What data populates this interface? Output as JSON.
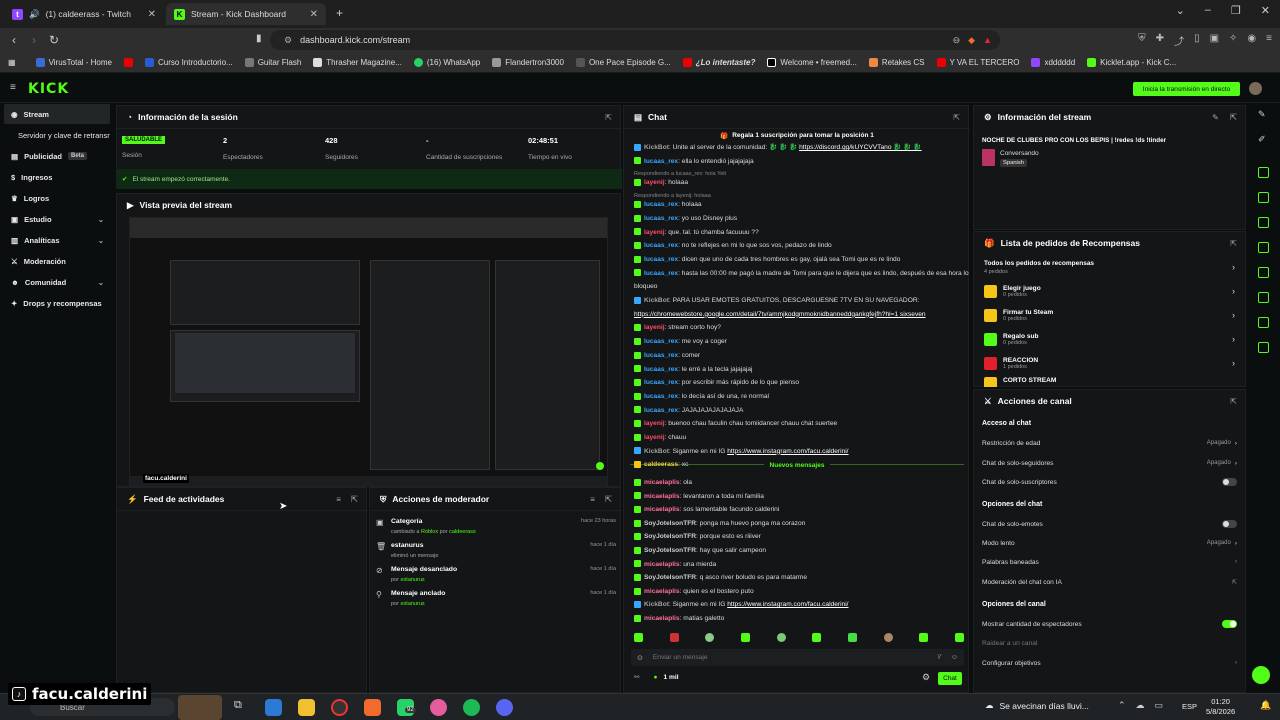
{
  "browser": {
    "tabs": [
      {
        "title": "(1) caldeerass - Twitch"
      },
      {
        "title": "Stream - Kick Dashboard"
      }
    ],
    "url": "dashboard.kick.com/stream",
    "bookmarks": [
      "VirusTotal - Home",
      "Curso Introductorio...",
      "Guitar Flash",
      "Thrasher Magazine...",
      "(16) WhatsApp",
      "Flandertron3000",
      "One Pace Episode G...",
      "¿Lo intentaste?",
      "Welcome • freemed...",
      "Retakes CS",
      "Y VA EL TERCERO",
      "xdddddd",
      "Kicklet.app - Kick C..."
    ]
  },
  "header": {
    "logo": "KICK",
    "go_live": "Inicia la transmisión en directo"
  },
  "sidebar": {
    "items": [
      {
        "label": "Stream"
      },
      {
        "label": "Servidor y clave de retransmisión"
      },
      {
        "label": "Publicidad",
        "badge": "Beta"
      },
      {
        "label": "Ingresos"
      },
      {
        "label": "Logros"
      },
      {
        "label": "Estudio"
      },
      {
        "label": "Analíticas"
      },
      {
        "label": "Moderación"
      },
      {
        "label": "Comunidad"
      },
      {
        "label": "Drops y recompensas"
      }
    ]
  },
  "session": {
    "title": "Información de la sesión",
    "status": "SALUDABLE",
    "status_label": "Sesión",
    "viewers": "2",
    "viewers_label": "Espectadores",
    "followers": "428",
    "followers_label": "Seguidores",
    "subs": "-",
    "subs_label": "Cantidad de suscripciones",
    "time": "02:48:51",
    "time_label": "Tiempo en vivo",
    "notice": "El stream empezó correctamente."
  },
  "preview": {
    "title": "Vista previa del stream",
    "overlay_name": "facu.calderini"
  },
  "feed": {
    "title": "Feed de actividades"
  },
  "modactions": {
    "title": "Acciones de moderador",
    "items": [
      {
        "title": "Categoría",
        "sub_pre": "cambiado a",
        "sub_a": "Roblox",
        "sub_mid": "por",
        "sub_b": "caldeerass",
        "time": "hace 23 horas"
      },
      {
        "title": "estanurus",
        "sub_pre": "eliminó un mensaje",
        "sub_a": "",
        "sub_mid": "",
        "sub_b": "",
        "time": "hace 1 día"
      },
      {
        "title": "Mensaje desanclado",
        "sub_pre": "por",
        "sub_a": "estanurus",
        "sub_mid": "",
        "sub_b": "",
        "time": "hace 1 día"
      },
      {
        "title": "Mensaje anclado",
        "sub_pre": "por",
        "sub_a": "estanurus",
        "sub_mid": "",
        "sub_b": "",
        "time": "hace 1 día"
      }
    ]
  },
  "chat": {
    "title": "Chat",
    "banner": "Regala 1 suscripción para tomar la posición 1",
    "new_messages": "Nuevos mensajes",
    "placeholder": "Enviar un mensaje",
    "viewers": "1 mil",
    "send": "Chat",
    "messages": [
      {
        "user": "KickBot",
        "color": "#a0a0a0",
        "text": "Unite al server de la comunidad: 🐉 🐉 🐉",
        "link": "https://discord.gg/kUYCVVTano 🐉 🐉 🐉"
      },
      {
        "user": "lucaas_rex",
        "color": "#3aa7ff",
        "text": "ella lo entendió jajajajaja"
      },
      {
        "reply": "Respondiendo a lucaas_rex: hola Yeti"
      },
      {
        "user": "layenij",
        "color": "#ff4d6a",
        "text": "holaaa"
      },
      {
        "reply": "Respondiendo a layenij: holaaa"
      },
      {
        "user": "lucaas_rex",
        "color": "#3aa7ff",
        "text": "holaaa"
      },
      {
        "user": "lucaas_rex",
        "color": "#3aa7ff",
        "text": "yo uso Disney plus"
      },
      {
        "user": "layenij",
        "color": "#ff4d6a",
        "text": "que. tal. tú chamba facuuuu ??"
      },
      {
        "user": "lucaas_rex",
        "color": "#3aa7ff",
        "text": "no te reflejes en mi lo que sos vos, pedazo de lindo"
      },
      {
        "user": "lucaas_rex",
        "color": "#3aa7ff",
        "text": "dicen que uno de cada tres hombres es gay, ojalá sea Tomi que es re lindo"
      },
      {
        "user": "lucaas_rex",
        "color": "#3aa7ff",
        "text": "hasta las 00:00 me pagó la madre de Tomi para que le dijera que es lindo, después de esa hora lo"
      },
      {
        "cont": "bloqueo"
      },
      {
        "user": "KickBot",
        "color": "#a0a0a0",
        "text": "PARA USAR EMOTES GRATUITOS, DESCARGUESNE 7TV EN SU NAVEGADOR:"
      },
      {
        "cont": "https://chromewebstore.google.com/detail/7tv/ammjkodgmmoknidbanneddgankgfejfh?hl=1 sixseven",
        "link_line": true
      },
      {
        "user": "layenij",
        "color": "#ff4d6a",
        "text": "stream corto hoy?"
      },
      {
        "user": "lucaas_rex",
        "color": "#3aa7ff",
        "text": "me voy a coger"
      },
      {
        "user": "lucaas_rex",
        "color": "#3aa7ff",
        "text": "comer"
      },
      {
        "user": "lucaas_rex",
        "color": "#3aa7ff",
        "text": "le erré a la tecla jajajajaj"
      },
      {
        "user": "lucaas_rex",
        "color": "#3aa7ff",
        "text": "por escribir más rápido de lo que pienso"
      },
      {
        "user": "lucaas_rex",
        "color": "#3aa7ff",
        "text": "lo decía así de una, re normal"
      },
      {
        "user": "lucaas_rex",
        "color": "#3aa7ff",
        "text": "JAJAJAJAJAJAJAJA"
      },
      {
        "user": "layenij",
        "color": "#ff4d6a",
        "text": "buenoo chau faculin chau tomiidancer chauu chat suertee"
      },
      {
        "user": "layenij",
        "color": "#ff4d6a",
        "text": "chauu"
      },
      {
        "user": "KickBot",
        "color": "#a0a0a0",
        "text": "Siganme en mi IG",
        "link": "https://www.instagram.com/facu.calderini/"
      },
      {
        "user": "caldeerass",
        "color": "#f5d142",
        "text": "xc"
      }
    ],
    "messages2": [
      {
        "user": "micaelaplis",
        "color": "#ff6f9c",
        "text": "ola"
      },
      {
        "user": "micaelaplis",
        "color": "#ff6f9c",
        "text": "levantaron a toda mi familia"
      },
      {
        "user": "micaelaplis",
        "color": "#ff6f9c",
        "text": "sos lamentable facundo calderini"
      },
      {
        "user": "SoyJotelsonTFR",
        "color": "#cfcfcf",
        "text": "ponga ma huevo ponga ma corazon"
      },
      {
        "user": "SoyJotelsonTFR",
        "color": "#cfcfcf",
        "text": "porque esto es riiiver"
      },
      {
        "user": "SoyJotelsonTFR",
        "color": "#cfcfcf",
        "text": "hay que salir campeon"
      },
      {
        "user": "micaelaplis",
        "color": "#ff6f9c",
        "text": "una mierda"
      },
      {
        "user": "SoyJotelsonTFR",
        "color": "#cfcfcf",
        "text": "q asco river boludo es para matarme"
      },
      {
        "user": "micaelaplis",
        "color": "#ff6f9c",
        "text": "quien es el bostero puto"
      },
      {
        "user": "KickBot",
        "color": "#a0a0a0",
        "text": "Siganme en mi IG",
        "link": "https://www.instagram.com/facu.calderini/"
      },
      {
        "user": "micaelaplis",
        "color": "#ff6f9c",
        "text": "matias galetto"
      }
    ]
  },
  "streaminfo": {
    "title": "Información del stream",
    "stream_title": "NOCHE DE CLUBES PRO CON LOS BEPIS | !redes !ds !tinder",
    "category": "Conversando",
    "lang": "Spanish"
  },
  "rewards": {
    "title": "Lista de pedidos de Recompensas",
    "all": "Todos los pedidos de recompensas",
    "all_count": "4 pedidos",
    "items": [
      {
        "name": "Elegir juego",
        "count": "0 pedidos",
        "color": "#f5c518"
      },
      {
        "name": "Firmar tu Steam",
        "count": "0 pedidos",
        "color": "#f5c518"
      },
      {
        "name": "Regalo sub",
        "count": "0 pedidos",
        "color": "#53fc18"
      },
      {
        "name": "REACCION",
        "count": "1 pedidos",
        "color": "#e0202a"
      },
      {
        "name": "CORTO STREAM",
        "count": "",
        "color": "#f5c518"
      }
    ]
  },
  "channel": {
    "title": "Acciones de canal",
    "chat_access": "Acceso al chat",
    "age": "Restricción de edad",
    "age_v": "Apagado",
    "followers_only": "Chat de solo-seguidores",
    "followers_only_v": "Apagado",
    "subs_only": "Chat de solo-suscriptores",
    "chat_options": "Opciones del chat",
    "emotes_only": "Chat de solo-emotes",
    "slow": "Modo lento",
    "slow_v": "Apagado",
    "banned_words": "Palabras baneadas",
    "ai_mod": "Moderación del chat con IA",
    "channel_options": "Opciones del canal",
    "show_viewers": "Mostrar cantidad de espectadores",
    "raid": "Raidear a un canal",
    "goals": "Configurar objetivos"
  },
  "taskbar": {
    "search": "Buscar",
    "weather": "Se avecinan días lluvi...",
    "lang": "ESP",
    "time": "01:20",
    "date": "5/8/2026",
    "badge": "92"
  },
  "watermark": "facu.calderini"
}
